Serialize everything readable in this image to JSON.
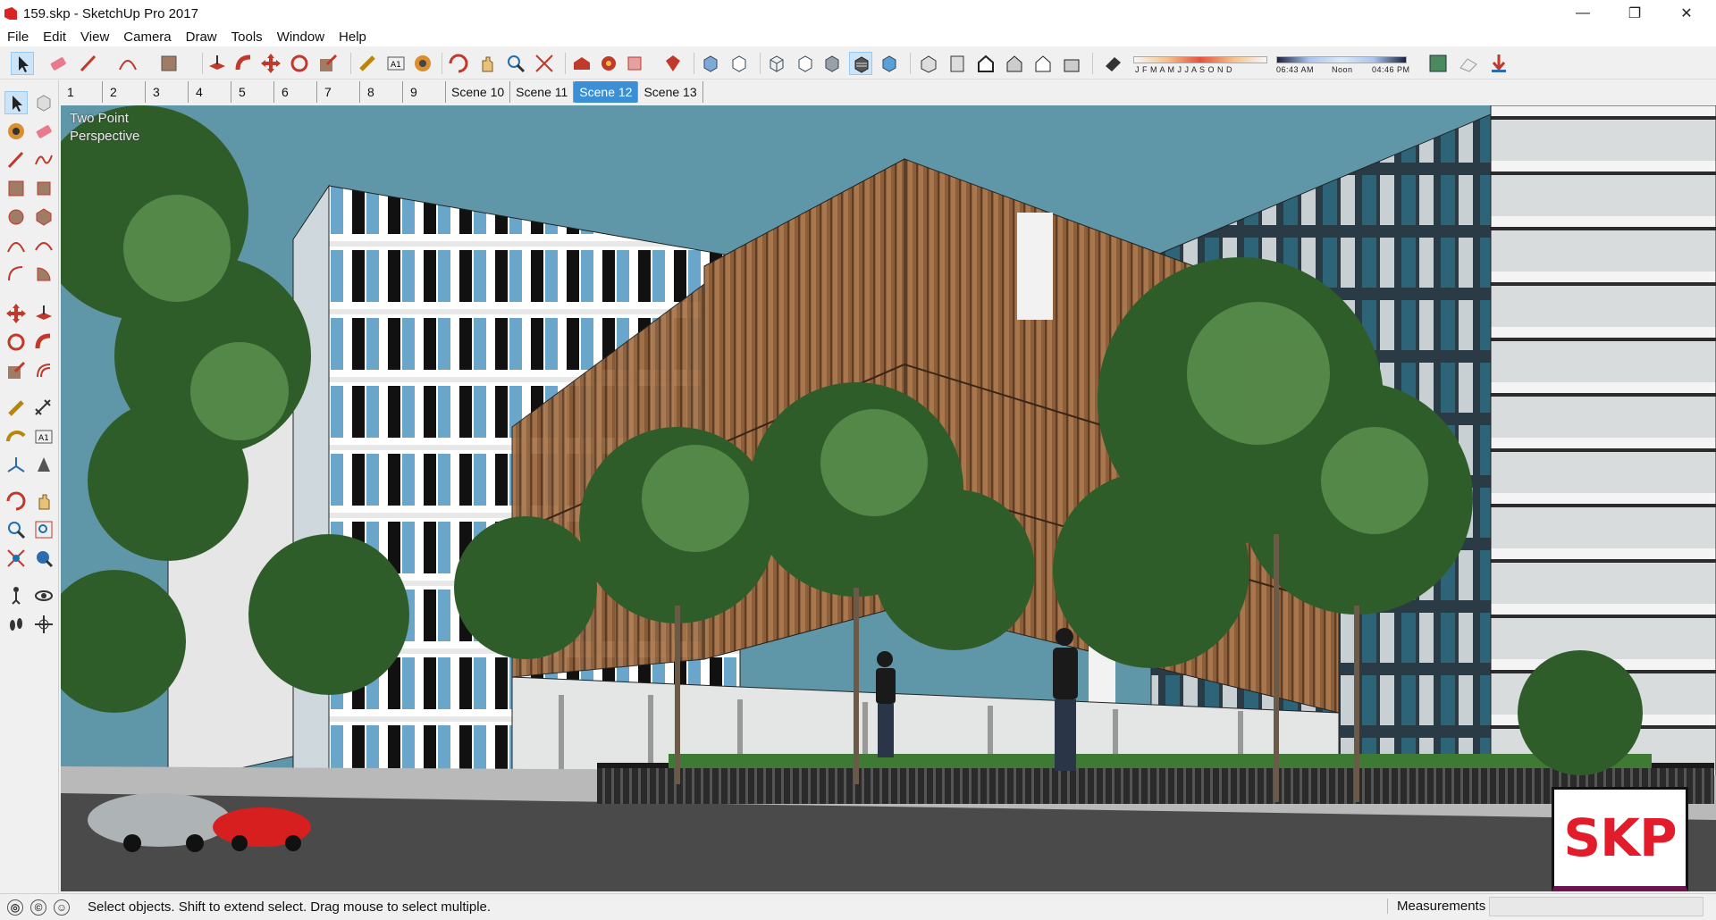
{
  "window": {
    "title": "159.skp - SketchUp Pro 2017",
    "minimize": "—",
    "maximize": "❐",
    "close": "✕"
  },
  "menu": [
    "File",
    "Edit",
    "View",
    "Camera",
    "Draw",
    "Tools",
    "Window",
    "Help"
  ],
  "shadow": {
    "months": "J F M A M J J A S O N D",
    "time_start": "06:43 AM",
    "time_mid": "Noon",
    "time_end": "04:46 PM"
  },
  "scenes": {
    "numbered": [
      "1",
      "2",
      "3",
      "4",
      "5",
      "6",
      "7",
      "8",
      "9"
    ],
    "named": [
      "Scene 10",
      "Scene 11",
      "Scene 12",
      "Scene 13"
    ],
    "active": "Scene 12"
  },
  "viewport": {
    "camera_label": "Two Point\nPerspective",
    "badge": "SKP"
  },
  "status": {
    "message": "Select objects. Shift to extend select. Drag mouse to select multiple.",
    "measurements_label": "Measurements",
    "measurements_value": ""
  },
  "colors": {
    "sky": "#5f97a8",
    "accent": "#3a8fd6",
    "wood": "#8b5e3c",
    "badge_red": "#e11d2b"
  },
  "icons": {
    "top_toolbar": [
      "select-icon",
      "eraser-icon",
      "line-icon",
      "arc-icon",
      "shape-icon",
      "push-pull-icon",
      "follow-me-icon",
      "move-icon",
      "rotate-icon",
      "scale-icon",
      "tape-icon",
      "text-icon",
      "paint-icon",
      "orbit-icon",
      "pan-icon",
      "zoom-icon",
      "zoom-extents-icon",
      "warehouse-icon",
      "extension-icon",
      "share-model-icon",
      "ruby-icon",
      "xray-icon",
      "back-edges-icon",
      "wireframe-icon",
      "hidden-line-icon",
      "shaded-icon",
      "textured-icon",
      "monochrome-icon",
      "iso-icon",
      "top-icon",
      "front-icon",
      "right-icon",
      "back-icon",
      "left-icon",
      "shadows-toggle-icon",
      "add-location-icon",
      "terrain-icon",
      "import-icon"
    ],
    "left_toolbar": [
      "select-icon",
      "make-component-icon",
      "paint-bucket-icon",
      "eraser-icon",
      "line-icon",
      "freehand-icon",
      "rectangle-icon",
      "rotated-rect-icon",
      "circle-icon",
      "polygon-icon",
      "arc-icon",
      "two-point-arc-icon",
      "three-point-arc-icon",
      "pie-icon",
      "move-icon",
      "push-pull-icon",
      "rotate-icon",
      "follow-me-icon",
      "scale-icon",
      "offset-icon",
      "tape-icon",
      "dimension-icon",
      "protractor-icon",
      "text-icon",
      "axes-icon",
      "section-plane-icon",
      "orbit-icon",
      "pan-icon",
      "zoom-icon",
      "zoom-window-icon",
      "zoom-extents-icon",
      "previous-view-icon",
      "position-camera-icon",
      "look-around-icon",
      "walk-icon",
      "section-fill-icon"
    ]
  }
}
